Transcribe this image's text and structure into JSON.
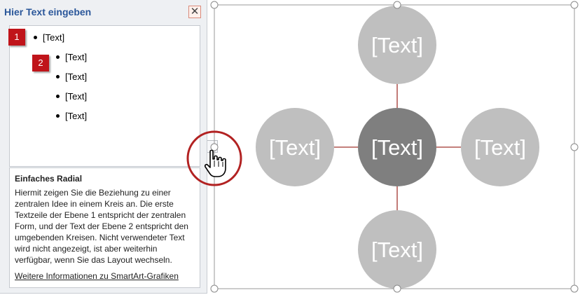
{
  "text_pane": {
    "title": "Hier Text eingeben",
    "close_glyph": "✕",
    "items": [
      {
        "level": 1,
        "text": "[Text]"
      },
      {
        "level": 2,
        "text": "[Text]"
      },
      {
        "level": 2,
        "text": "[Text]"
      },
      {
        "level": 2,
        "text": "[Text]"
      },
      {
        "level": 2,
        "text": "[Text]"
      }
    ],
    "markers": [
      "1",
      "2"
    ],
    "marker_color": "#c0141a",
    "description": {
      "title": "Einfaches Radial",
      "body": "Hiermit zeigen Sie die Beziehung zu einer zentralen Idee in einem Kreis an. Die erste Textzeile der Ebene 1 entspricht der zentralen Form, und der Text der Ebene 2 entspricht den umgebenden Kreisen. Nicht verwendeter Text wird nicht angezeigt, ist aber weiterhin verfügbar, wenn Sie das Layout wechseln.",
      "link": "Weitere Informationen zu SmartArt-Grafiken"
    }
  },
  "collapse_glyph": "›",
  "smartart": {
    "center_text": "[Text]",
    "outer_texts": [
      "[Text]",
      "[Text]",
      "[Text]",
      "[Text]"
    ],
    "center_color": "#7f7f7f",
    "outer_color": "#bfbfbf",
    "connector_color": "#a0342f",
    "highlight_circle_color": "#b22222"
  }
}
